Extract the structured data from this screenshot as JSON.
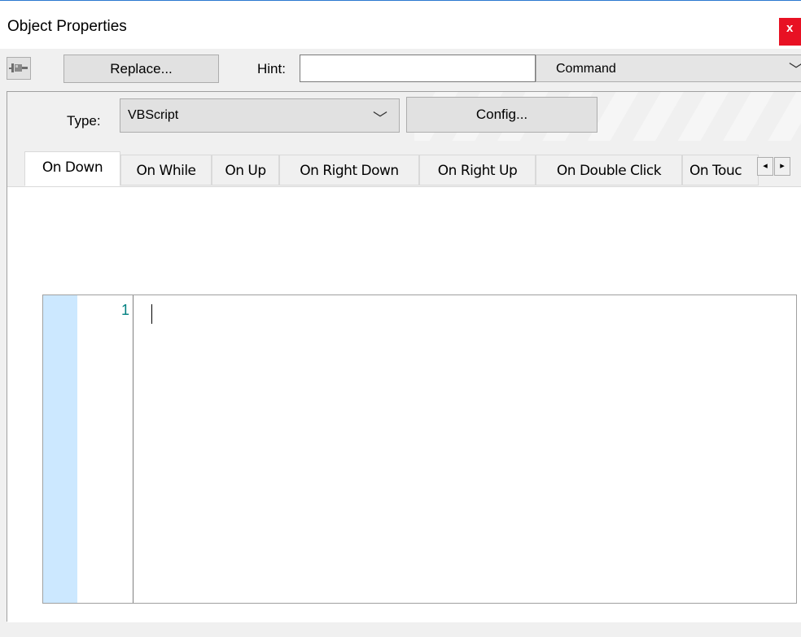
{
  "window": {
    "title": "Object Properties",
    "close_glyph": "x"
  },
  "toolbar": {
    "pin_icon": "pushpin-icon",
    "replace_label": "Replace...",
    "hint_label": "Hint:",
    "hint_value": "",
    "command_value": "Command"
  },
  "settings": {
    "type_label": "Type:",
    "type_value": "VBScript",
    "config_label": "Config..."
  },
  "tabs": [
    {
      "label": "On Down",
      "active": true
    },
    {
      "label": "On While"
    },
    {
      "label": "On Up"
    },
    {
      "label": "On Right Down"
    },
    {
      "label": "On Right Up"
    },
    {
      "label": "On Double Click"
    },
    {
      "label": "On Touc"
    }
  ],
  "tab_scroll": {
    "left_glyph": "◂",
    "right_glyph": "▸"
  },
  "editor": {
    "line_numbers": [
      "1"
    ],
    "content": ""
  },
  "colors": {
    "close": "#e81123",
    "gutter_margin": "#cce8ff",
    "line_number": "#008080"
  }
}
